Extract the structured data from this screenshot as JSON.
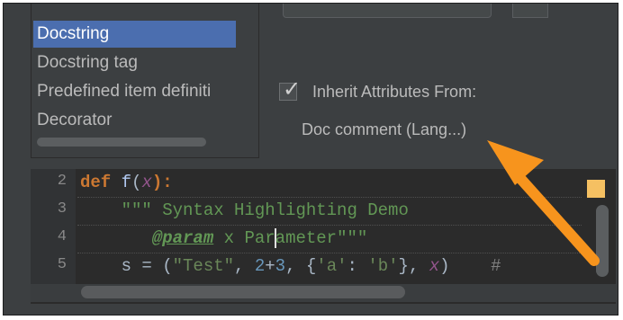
{
  "element_list": {
    "items": [
      {
        "label": "Docstring",
        "selected": true
      },
      {
        "label": "Docstring tag",
        "selected": false
      },
      {
        "label": "Predefined item definiti",
        "selected": false
      },
      {
        "label": "Decorator",
        "selected": false
      }
    ]
  },
  "inherit": {
    "checked": true,
    "label": "Inherit Attributes From:",
    "value": "Doc comment (Lang...)"
  },
  "preview": {
    "line_numbers": [
      "2",
      "3",
      "4",
      "5"
    ],
    "line2": {
      "kw": "def",
      "fn": "f",
      "open": "(",
      "param": "x",
      "close": "):"
    },
    "line3": {
      "indent": "    ",
      "doc": "\"\"\" Syntax Highlighting Demo"
    },
    "line4": {
      "indent": "       ",
      "tag": "@param",
      "doc_a": " x Par",
      "doc_b": "ameter\"\"\""
    },
    "line5": {
      "indent": "    ",
      "a": "s = (",
      "s1": "\"Test\"",
      "b": ", ",
      "n1": "2",
      "c": "+",
      "n2": "3",
      "d": ", {",
      "s2": "'a'",
      "e": ": ",
      "s3": "'b'",
      "f": "}, ",
      "param": "x",
      "g": ")",
      "h": "    #"
    }
  },
  "colors": {
    "selection": "#4b6eaf",
    "annotation_arrow": "#f7941d",
    "marker": "#f5c062"
  }
}
